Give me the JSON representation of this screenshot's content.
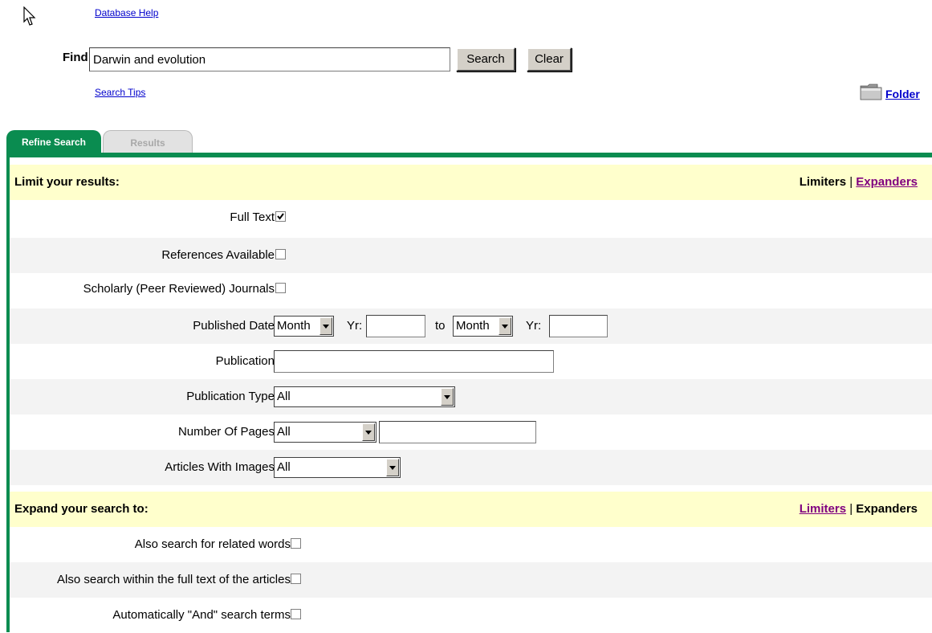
{
  "header": {
    "database_help": "Database Help",
    "find_label": "Find:",
    "find_value": "Darwin and evolution",
    "search_button": "Search",
    "clear_button": "Clear",
    "search_tips": "Search Tips",
    "folder_label": "Folder"
  },
  "tabs": [
    {
      "label": "Refine Search",
      "active": true
    },
    {
      "label": "Results",
      "active": false
    }
  ],
  "limits": {
    "title": "Limit your results:",
    "links_current": "Limiters",
    "links_separator": "|",
    "links_other": "Expanders",
    "full_text": {
      "label": "Full Text",
      "checked": true
    },
    "references": {
      "label": "References Available",
      "checked": false
    },
    "scholarly": {
      "label": "Scholarly (Peer Reviewed) Journals",
      "checked": false
    },
    "published_date": {
      "label": "Published Date",
      "from_month": "Month",
      "yr_label": "Yr:",
      "to_label": "to",
      "to_month": "Month",
      "from_year": "",
      "to_year": ""
    },
    "publication": {
      "label": "Publication",
      "value": ""
    },
    "publication_type": {
      "label": "Publication Type",
      "value": "All"
    },
    "number_of_pages": {
      "label": "Number Of Pages",
      "value": "All",
      "text": ""
    },
    "articles_with_images": {
      "label": "Articles With Images",
      "value": "All"
    }
  },
  "expanders": {
    "title": "Expand your search to:",
    "links_other": "Limiters",
    "links_separator": "|",
    "links_current": "Expanders",
    "related_words": {
      "label": "Also search for related words",
      "checked": false
    },
    "full_text_articles": {
      "label": "Also search within the full text of the articles",
      "checked": false
    },
    "and_terms": {
      "label": "Automatically \"And\" search terms",
      "checked": false
    }
  },
  "colors": {
    "accent_green": "#0a8c50",
    "header_yellow": "#ffffcc",
    "link_blue": "#0000cc",
    "visited_purple": "#800080"
  }
}
